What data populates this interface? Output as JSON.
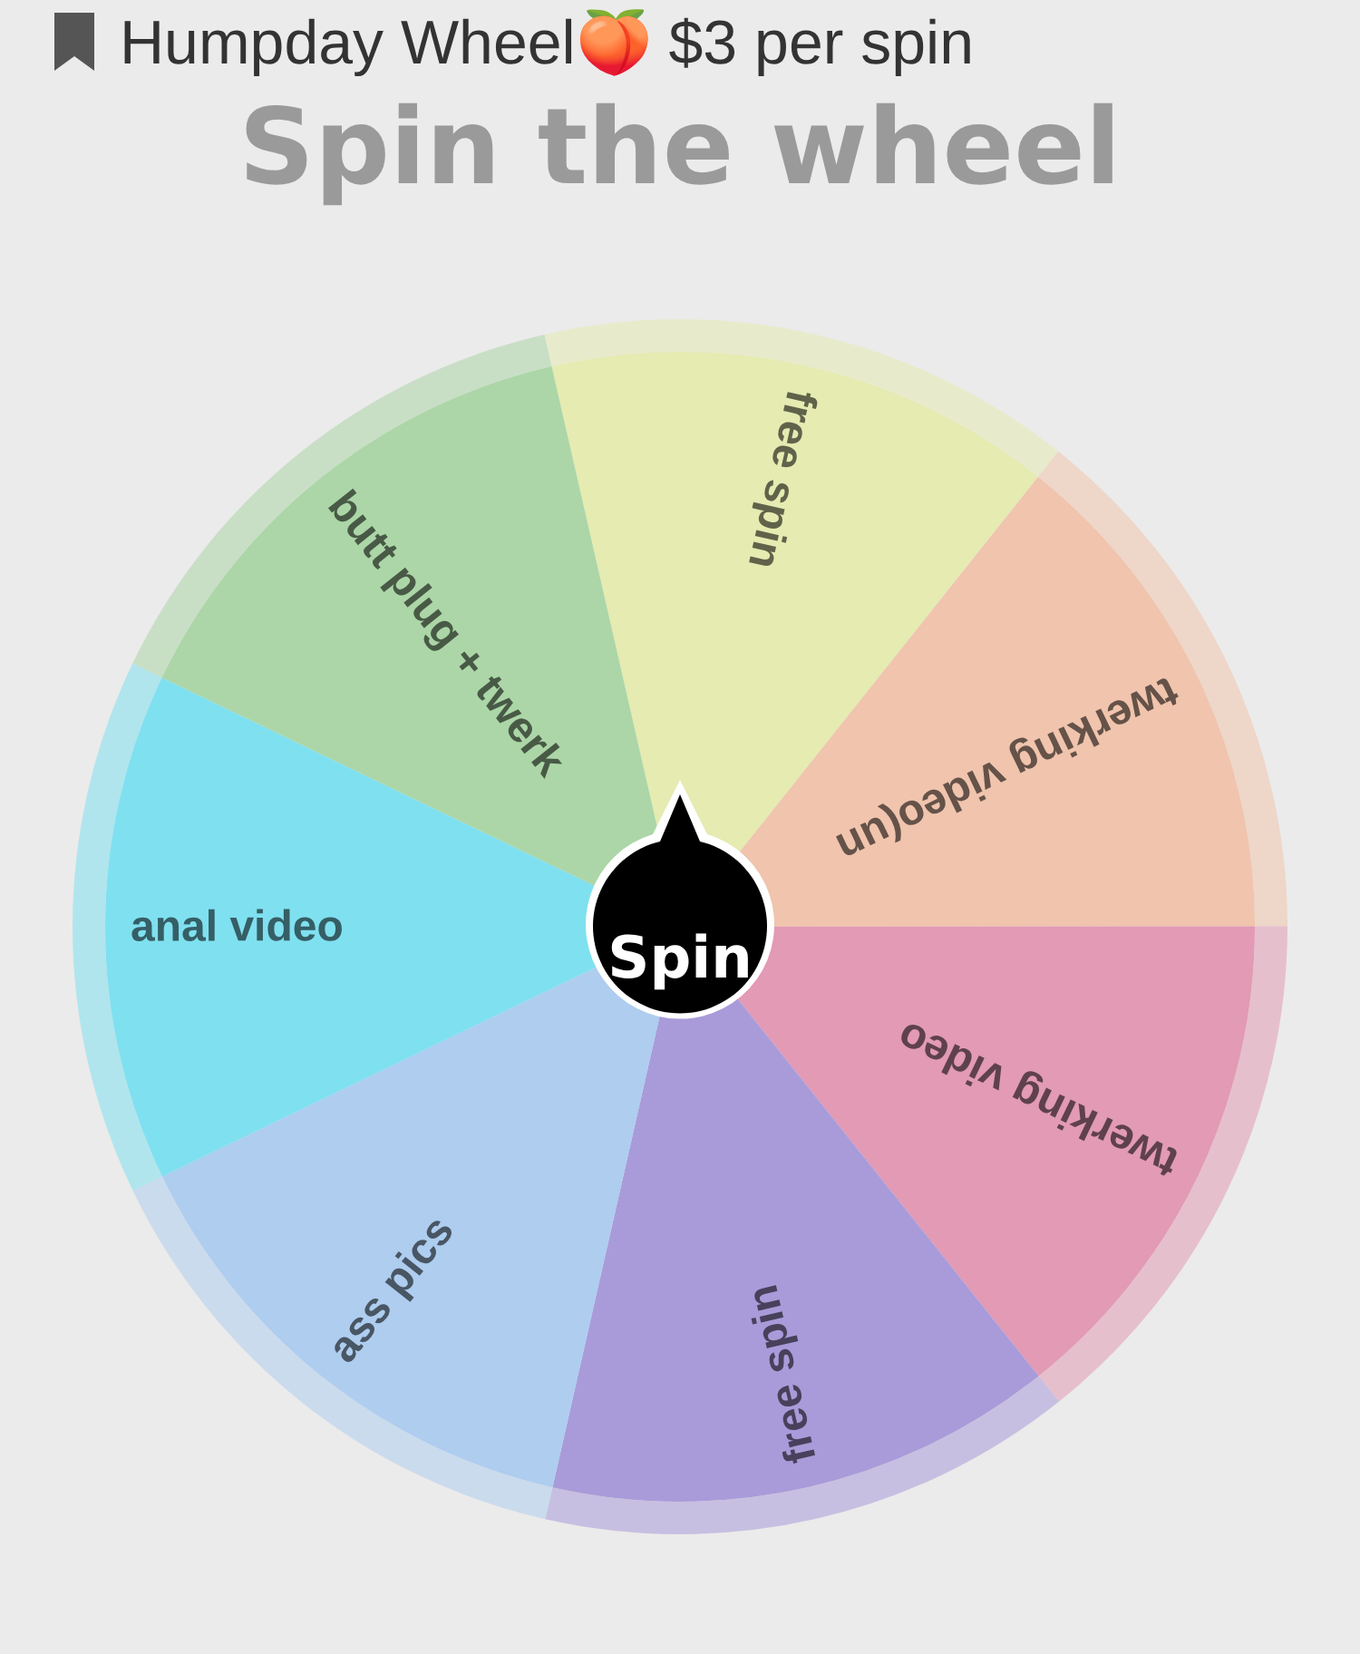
{
  "header": {
    "title": "Humpday Wheel🍑 $3 per spin"
  },
  "heading": "Spin the wheel",
  "wheel": {
    "button": "Spin",
    "segments": [
      {
        "label": "free spin",
        "color": "#e5ebb1"
      },
      {
        "label": "twerking video(un",
        "color": "#f0c4ad"
      },
      {
        "label": "twerking video",
        "color": "#e29ab5"
      },
      {
        "label": "free spin",
        "color": "#a99bd9"
      },
      {
        "label": "ass pics",
        "color": "#aecdef"
      },
      {
        "label": "anal video",
        "color": "#7fe0f0"
      },
      {
        "label": "butt plug + twerk",
        "color": "#acd6a7"
      }
    ]
  }
}
